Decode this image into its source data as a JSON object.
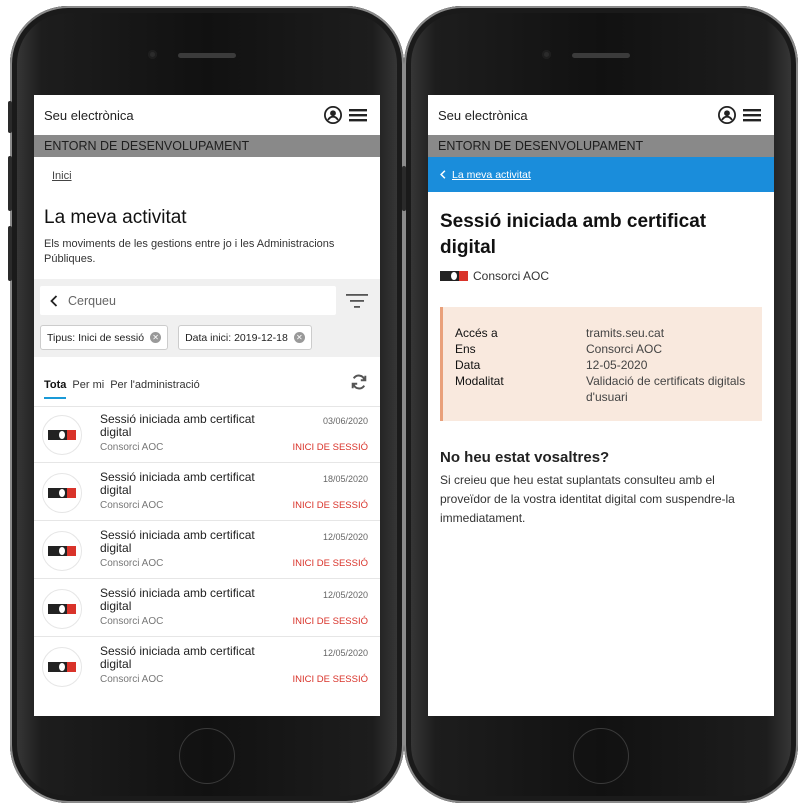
{
  "brand": "Seu electrònica",
  "environment": "ENTORN DE DESENVOLUPAMENT",
  "list_screen": {
    "breadcrumb": "Inici",
    "title": "La meva activitat",
    "description": "Els moviments de les gestions entre jo i les Administracions Públiques.",
    "search_placeholder": "Cerqueu",
    "filters": [
      "Tipus: Inici de sessió",
      "Data inici: 2019-12-18"
    ],
    "tabs": [
      {
        "label": "Tota",
        "active": true
      },
      {
        "label": "Per mi",
        "active": false
      },
      {
        "label": "Per l'administració",
        "active": false
      }
    ],
    "items": [
      {
        "title": "Sessió iniciada amb certificat digital",
        "date": "03/06/2020",
        "org": "Consorci AOC",
        "status": "INICI DE SESSIÓ"
      },
      {
        "title": "Sessió iniciada amb certificat digital",
        "date": "18/05/2020",
        "org": "Consorci AOC",
        "status": "INICI DE SESSIÓ"
      },
      {
        "title": "Sessió iniciada amb certificat digital",
        "date": "12/05/2020",
        "org": "Consorci AOC",
        "status": "INICI DE SESSIÓ"
      },
      {
        "title": "Sessió iniciada amb certificat digital",
        "date": "12/05/2020",
        "org": "Consorci AOC",
        "status": "INICI DE SESSIÓ"
      },
      {
        "title": "Sessió iniciada amb certificat digital",
        "date": "12/05/2020",
        "org": "Consorci AOC",
        "status": "INICI DE SESSIÓ"
      }
    ]
  },
  "detail_screen": {
    "back_label": "La meva activitat",
    "title": "Sessió iniciada amb certificat digital",
    "org": "Consorci AOC",
    "info": [
      {
        "key": "Accés a",
        "value": "tramits.seu.cat"
      },
      {
        "key": "Ens",
        "value": "Consorci AOC"
      },
      {
        "key": "Data",
        "value": "12-05-2020"
      },
      {
        "key": "Modalitat",
        "value": "Validació de certificats digitals d'usuari"
      }
    ],
    "sub_title": "No heu estat vosaltres?",
    "sub_text": "Si creieu que heu estat suplantats consulteu amb el proveïdor de la vostra identitat digital com suspendre-la immediatament."
  },
  "colors": {
    "accent": "#1a8ddb",
    "status_red": "#d9332a",
    "env_bar": "#898989",
    "info_bg": "#f9e9de",
    "info_border": "#e9a07a"
  },
  "icons": [
    "user-icon",
    "menu-icon",
    "chevron-left-icon",
    "filter-icon",
    "clear-icon",
    "refresh-icon",
    "aoc-logo-icon"
  ]
}
